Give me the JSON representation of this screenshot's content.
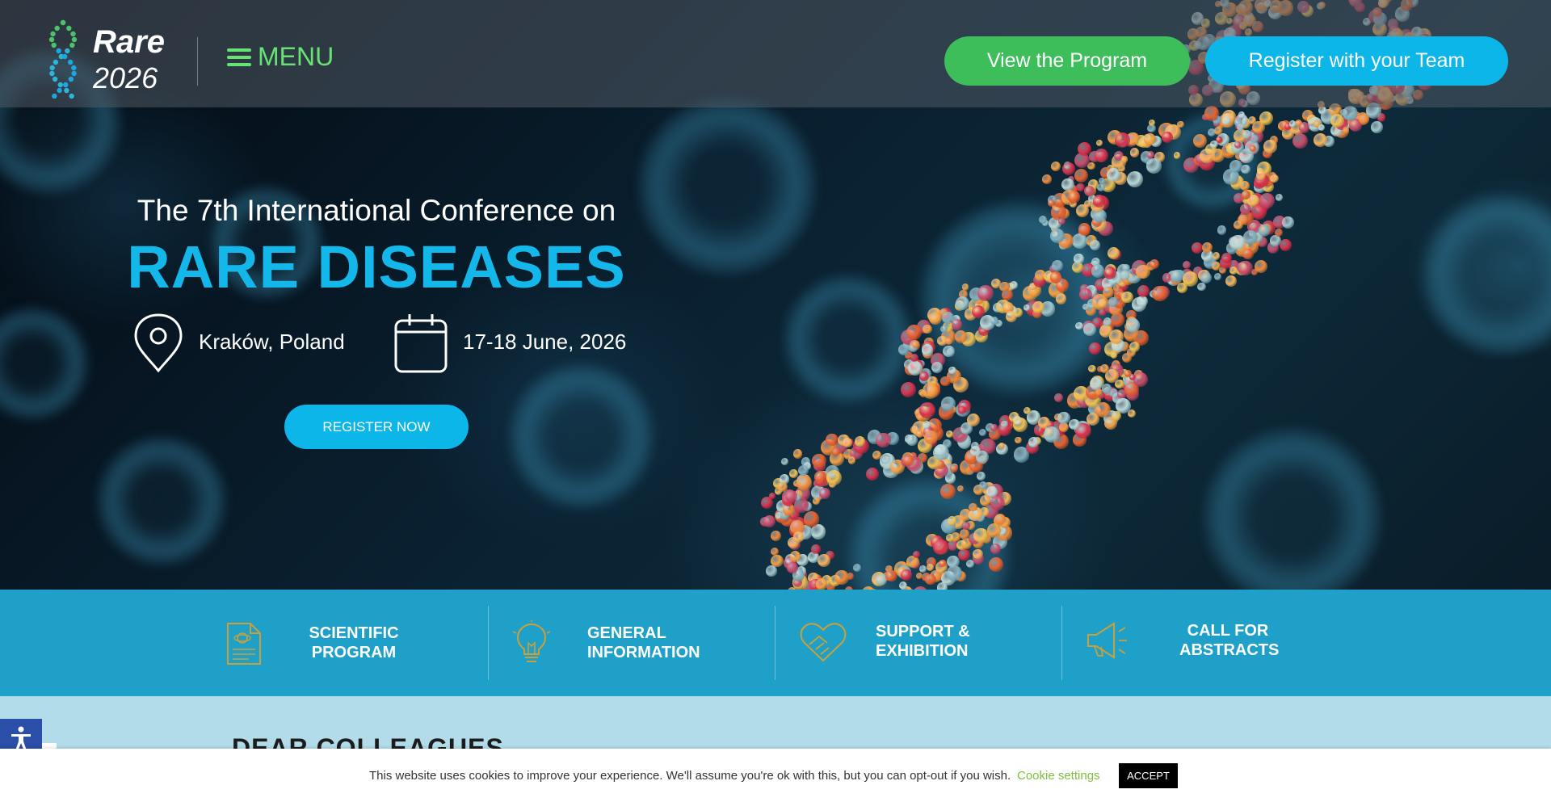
{
  "header": {
    "logo_title": "Rare",
    "logo_year": "2026",
    "menu_label": "MENU",
    "btn_program": "View the Program",
    "btn_team": "Register with your Team"
  },
  "hero": {
    "subtitle": "The 7th International Conference on",
    "title": "RARE DISEASES",
    "location": "Kraków, Poland",
    "dates": "17-18 June, 2026",
    "register_label": "REGISTER NOW"
  },
  "features": [
    {
      "line1": "SCIENTIFIC",
      "line2": "PROGRAM",
      "icon": "document-icon"
    },
    {
      "line1": "GENERAL",
      "line2": "INFORMATION",
      "icon": "lightbulb-icon"
    },
    {
      "line1": "SUPPORT &",
      "line2": "EXHIBITION",
      "icon": "handshake-icon"
    },
    {
      "line1": "CALL FOR",
      "line2": "ABSTRACTS",
      "icon": "megaphone-icon"
    }
  ],
  "lower": {
    "heading": "DEAR COLLEAGUES"
  },
  "cookie": {
    "text": "This website uses cookies to improve your experience. We'll assume you're ok with this, but you can opt-out if you wish.",
    "settings_label": "Cookie settings",
    "accept_label": "ACCEPT"
  },
  "colors": {
    "accent_blue": "#13b7ea",
    "accent_green": "#3ebd5b",
    "menu_green": "#67e374",
    "feature_bar": "#1fa0c8",
    "icon_gold": "#c9a03a"
  }
}
